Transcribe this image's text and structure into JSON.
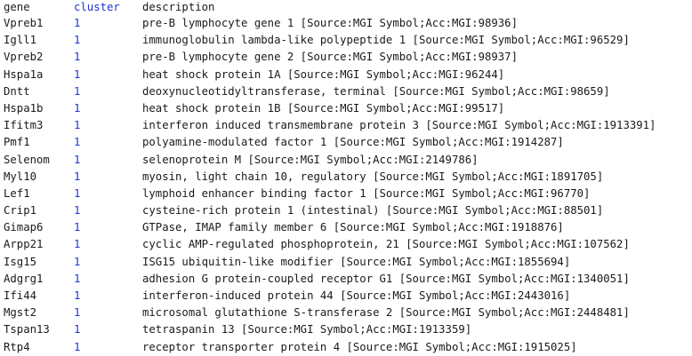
{
  "columns": {
    "gene": "gene",
    "cluster": "cluster",
    "description": "description"
  },
  "colors": {
    "cluster_text": "#1f33d6",
    "text": "#1a1a1a",
    "background": "#ffffff"
  },
  "rows": [
    {
      "gene": "Vpreb1",
      "cluster": "1",
      "description": "pre-B lymphocyte gene 1 [Source:MGI Symbol;Acc:MGI:98936]"
    },
    {
      "gene": "Igll1",
      "cluster": "1",
      "description": "immunoglobulin lambda-like polypeptide 1 [Source:MGI Symbol;Acc:MGI:96529]"
    },
    {
      "gene": "Vpreb2",
      "cluster": "1",
      "description": "pre-B lymphocyte gene 2 [Source:MGI Symbol;Acc:MGI:98937]"
    },
    {
      "gene": "Hspa1a",
      "cluster": "1",
      "description": "heat shock protein 1A [Source:MGI Symbol;Acc:MGI:96244]"
    },
    {
      "gene": "Dntt",
      "cluster": "1",
      "description": "deoxynucleotidyltransferase, terminal [Source:MGI Symbol;Acc:MGI:98659]"
    },
    {
      "gene": "Hspa1b",
      "cluster": "1",
      "description": "heat shock protein 1B [Source:MGI Symbol;Acc:MGI:99517]"
    },
    {
      "gene": "Ifitm3",
      "cluster": "1",
      "description": "interferon induced transmembrane protein 3 [Source:MGI Symbol;Acc:MGI:1913391]"
    },
    {
      "gene": "Pmf1",
      "cluster": "1",
      "description": "polyamine-modulated factor 1 [Source:MGI Symbol;Acc:MGI:1914287]"
    },
    {
      "gene": "Selenom",
      "cluster": "1",
      "description": "selenoprotein M [Source:MGI Symbol;Acc:MGI:2149786]"
    },
    {
      "gene": "Myl10",
      "cluster": "1",
      "description": "myosin, light chain 10, regulatory [Source:MGI Symbol;Acc:MGI:1891705]"
    },
    {
      "gene": "Lef1",
      "cluster": "1",
      "description": "lymphoid enhancer binding factor 1 [Source:MGI Symbol;Acc:MGI:96770]"
    },
    {
      "gene": "Crip1",
      "cluster": "1",
      "description": "cysteine-rich protein 1 (intestinal) [Source:MGI Symbol;Acc:MGI:88501]"
    },
    {
      "gene": "Gimap6",
      "cluster": "1",
      "description": "GTPase, IMAP family member 6 [Source:MGI Symbol;Acc:MGI:1918876]"
    },
    {
      "gene": "Arpp21",
      "cluster": "1",
      "description": "cyclic AMP-regulated phosphoprotein, 21 [Source:MGI Symbol;Acc:MGI:107562]"
    },
    {
      "gene": "Isg15",
      "cluster": "1",
      "description": "ISG15 ubiquitin-like modifier [Source:MGI Symbol;Acc:MGI:1855694]"
    },
    {
      "gene": "Adgrg1",
      "cluster": "1",
      "description": "adhesion G protein-coupled receptor G1 [Source:MGI Symbol;Acc:MGI:1340051]"
    },
    {
      "gene": "Ifi44",
      "cluster": "1",
      "description": "interferon-induced protein 44 [Source:MGI Symbol;Acc:MGI:2443016]"
    },
    {
      "gene": "Mgst2",
      "cluster": "1",
      "description": "microsomal glutathione S-transferase 2 [Source:MGI Symbol;Acc:MGI:2448481]"
    },
    {
      "gene": "Tspan13",
      "cluster": "1",
      "description": "tetraspanin 13 [Source:MGI Symbol;Acc:MGI:1913359]"
    },
    {
      "gene": "Rtp4",
      "cluster": "1",
      "description": "receptor transporter protein 4 [Source:MGI Symbol;Acc:MGI:1915025]"
    }
  ]
}
